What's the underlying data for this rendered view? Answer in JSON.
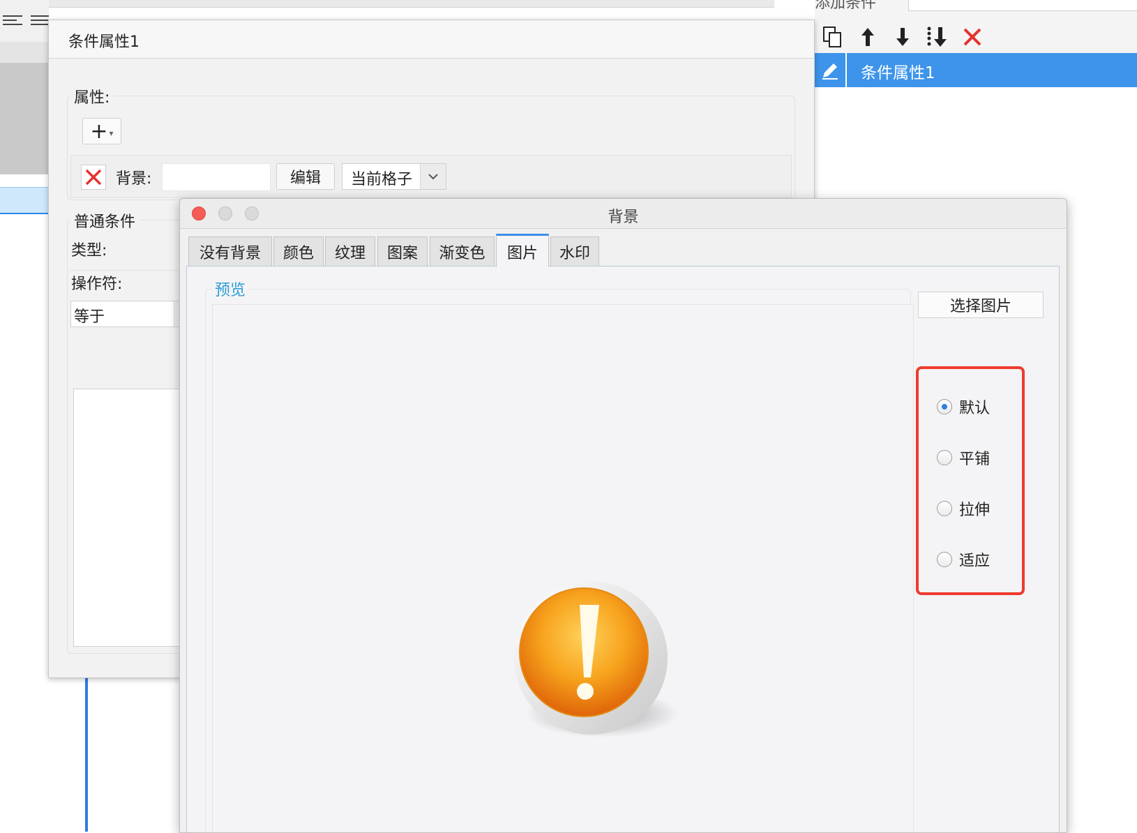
{
  "right_panel": {
    "top_label": "添加条件",
    "selected_item": "条件属性1"
  },
  "condition_dialog": {
    "title": "条件属性1",
    "attributes_legend": "属性:",
    "background_label": "背景:",
    "edit_button": "编辑",
    "scope_select": "当前格子",
    "normal_condition_legend": "普通条件",
    "type_label": "类型:",
    "operator_label": "操作符:",
    "operator_select": "等于"
  },
  "background_dialog": {
    "title": "背景",
    "tabs": [
      "没有背景",
      "颜色",
      "纹理",
      "图案",
      "渐变色",
      "图片",
      "水印"
    ],
    "active_tab": "图片",
    "preview_legend": "预览",
    "choose_image_button": "选择图片",
    "layout_options": [
      {
        "label": "默认",
        "checked": true
      },
      {
        "label": "平铺",
        "checked": false
      },
      {
        "label": "拉伸",
        "checked": false
      },
      {
        "label": "适应",
        "checked": false
      }
    ]
  },
  "colors": {
    "accent_blue": "#3d94ea",
    "highlight_red": "#ee3b2f",
    "preview_legend_blue": "#2a9cd9",
    "warning_orange": "#f28c0f"
  },
  "icons": [
    "align-left-icon",
    "align-justify-icon",
    "copy-icon",
    "arrow-up-icon",
    "arrow-down-icon",
    "move-bottom-icon",
    "delete-icon",
    "pencil-icon",
    "add-icon",
    "remove-icon",
    "chevron-down-icon",
    "warning-icon"
  ]
}
